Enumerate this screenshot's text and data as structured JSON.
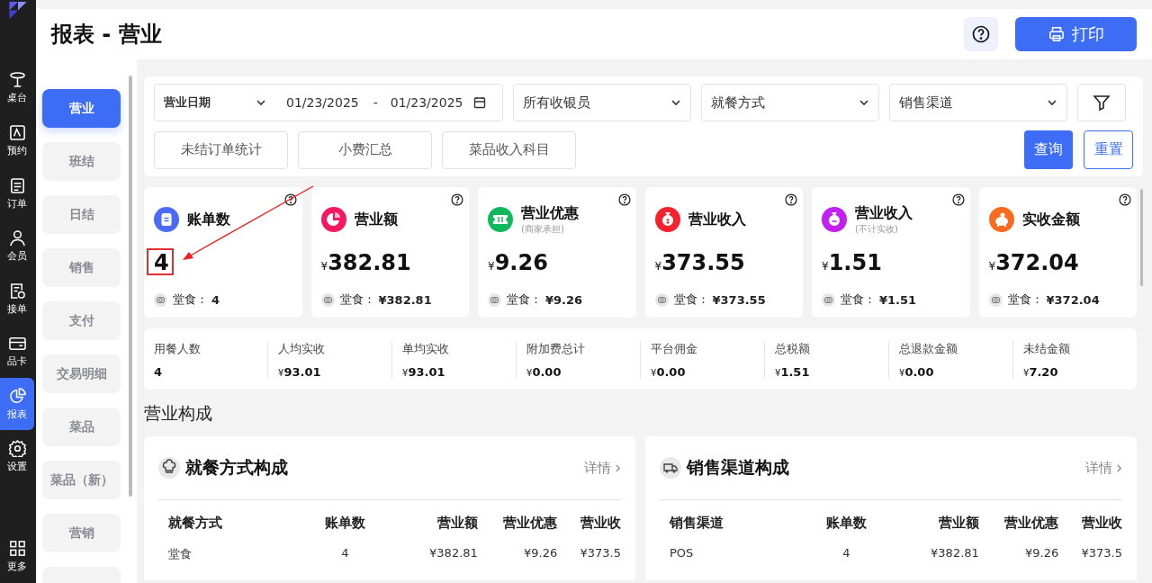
{
  "nav": [
    {
      "label": "桌台",
      "selected": false
    },
    {
      "label": "预约",
      "selected": false
    },
    {
      "label": "订单",
      "selected": false
    },
    {
      "label": "会员",
      "selected": false
    },
    {
      "label": "接单",
      "selected": false
    },
    {
      "label": "品卡",
      "selected": false
    },
    {
      "label": "报表",
      "selected": true
    },
    {
      "label": "设置",
      "selected": false
    },
    {
      "label": "更多",
      "selected": false
    }
  ],
  "header": {
    "title": "报表 - 营业",
    "print_button": "打印"
  },
  "report_tabs": [
    {
      "label": "营业",
      "selected": true
    },
    {
      "label": "班结",
      "selected": false
    },
    {
      "label": "日结",
      "selected": false
    },
    {
      "label": "销售",
      "selected": false
    },
    {
      "label": "支付",
      "selected": false
    },
    {
      "label": "交易明细",
      "selected": false
    },
    {
      "label": "菜品",
      "selected": false
    },
    {
      "label": "菜品（新）",
      "selected": false
    },
    {
      "label": "营销",
      "selected": false
    }
  ],
  "filters": {
    "date_type": "营业日期",
    "date_from": "01/23/2025",
    "date_sep": "-",
    "date_to": "01/23/2025",
    "cashier": "所有收银员",
    "dining_mode": "就餐方式",
    "channel": "销售渠道",
    "buttons": [
      "未结订单统计",
      "小费汇总",
      "菜品收入科目"
    ],
    "query": "查询",
    "reset": "重置"
  },
  "stat_cards": [
    {
      "title": "账单数",
      "color": "#4a6cf7",
      "value": "4",
      "highlighted": true,
      "sub_label": "堂食：",
      "sub_value": "4"
    },
    {
      "title": "营业额",
      "color": "#f5175f",
      "currency": "¥",
      "value": "382.81",
      "highlighted": false,
      "sub_label": "堂食：",
      "sub_value": "¥382.81"
    },
    {
      "title": "营业优惠",
      "subtitle": "(商家承担)",
      "color": "#11b95c",
      "currency": "¥",
      "value": "9.26",
      "highlighted": false,
      "sub_label": "堂食：",
      "sub_value": "¥9.26"
    },
    {
      "title": "营业收入",
      "color": "#f5222d",
      "currency": "¥",
      "value": "373.55",
      "highlighted": false,
      "sub_label": "堂食：",
      "sub_value": "¥373.55"
    },
    {
      "title": "营业收入",
      "subtitle": "(不计实收)",
      "color": "#c21ff0",
      "currency": "¥",
      "value": "1.51",
      "highlighted": false,
      "sub_label": "堂食：",
      "sub_value": "¥1.51"
    },
    {
      "title": "实收金额",
      "color": "#fa6a1f",
      "currency": "¥",
      "value": "372.04",
      "highlighted": false,
      "sub_label": "堂食：",
      "sub_value": "¥372.04"
    }
  ],
  "summary": [
    {
      "label": "用餐人数",
      "value": "4"
    },
    {
      "label": "人均实收",
      "currency": "¥",
      "value": "93.01"
    },
    {
      "label": "单均实收",
      "currency": "¥",
      "value": "93.01"
    },
    {
      "label": "附加费总计",
      "currency": "¥",
      "value": "0.00"
    },
    {
      "label": "平台佣金",
      "currency": "¥",
      "value": "0.00"
    },
    {
      "label": "总税额",
      "currency": "¥",
      "value": "1.51"
    },
    {
      "label": "总退款金额",
      "currency": "¥",
      "value": "0.00"
    },
    {
      "label": "未结金额",
      "currency": "¥",
      "value": "7.20"
    }
  ],
  "section_title": "营业构成",
  "panels": [
    {
      "title": "就餐方式构成",
      "details": "详情",
      "columns": [
        "就餐方式",
        "账单数",
        "营业额",
        "营业优惠",
        "营业收"
      ],
      "rows": [
        [
          "堂食",
          "4",
          "¥382.81",
          "¥9.26",
          "¥373.5"
        ]
      ]
    },
    {
      "title": "销售渠道构成",
      "details": "详情",
      "columns": [
        "销售渠道",
        "账单数",
        "营业额",
        "营业优惠",
        "营业收"
      ],
      "rows": [
        [
          "POS",
          "4",
          "¥382.81",
          "¥9.26",
          "¥373.5"
        ]
      ]
    }
  ]
}
